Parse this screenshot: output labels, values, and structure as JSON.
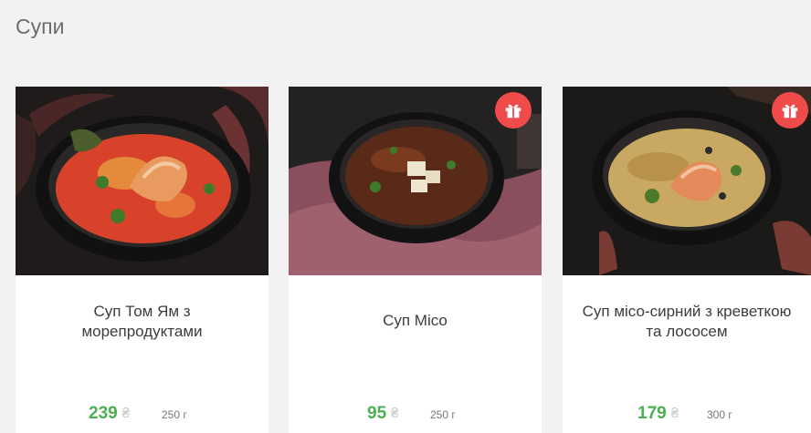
{
  "section": {
    "title": "Супи"
  },
  "products": [
    {
      "name": "Суп Том Ям з морепродуктами",
      "price": "239",
      "currency": "₴",
      "weight": "250 г",
      "gift_icon": false
    },
    {
      "name": "Суп Місо",
      "price": "95",
      "currency": "₴",
      "weight": "250 г",
      "gift_icon": "gift-icon"
    },
    {
      "name": "Суп місо-сирний з креветкою та лососем",
      "price": "179",
      "currency": "₴",
      "weight": "300 г",
      "gift_icon": "gift-icon"
    }
  ],
  "colors": {
    "background": "#f2f2f2",
    "card": "#ffffff",
    "price": "#4caf50",
    "gift_badge": "#ef4b4b",
    "currency": "#c7c7c7"
  }
}
